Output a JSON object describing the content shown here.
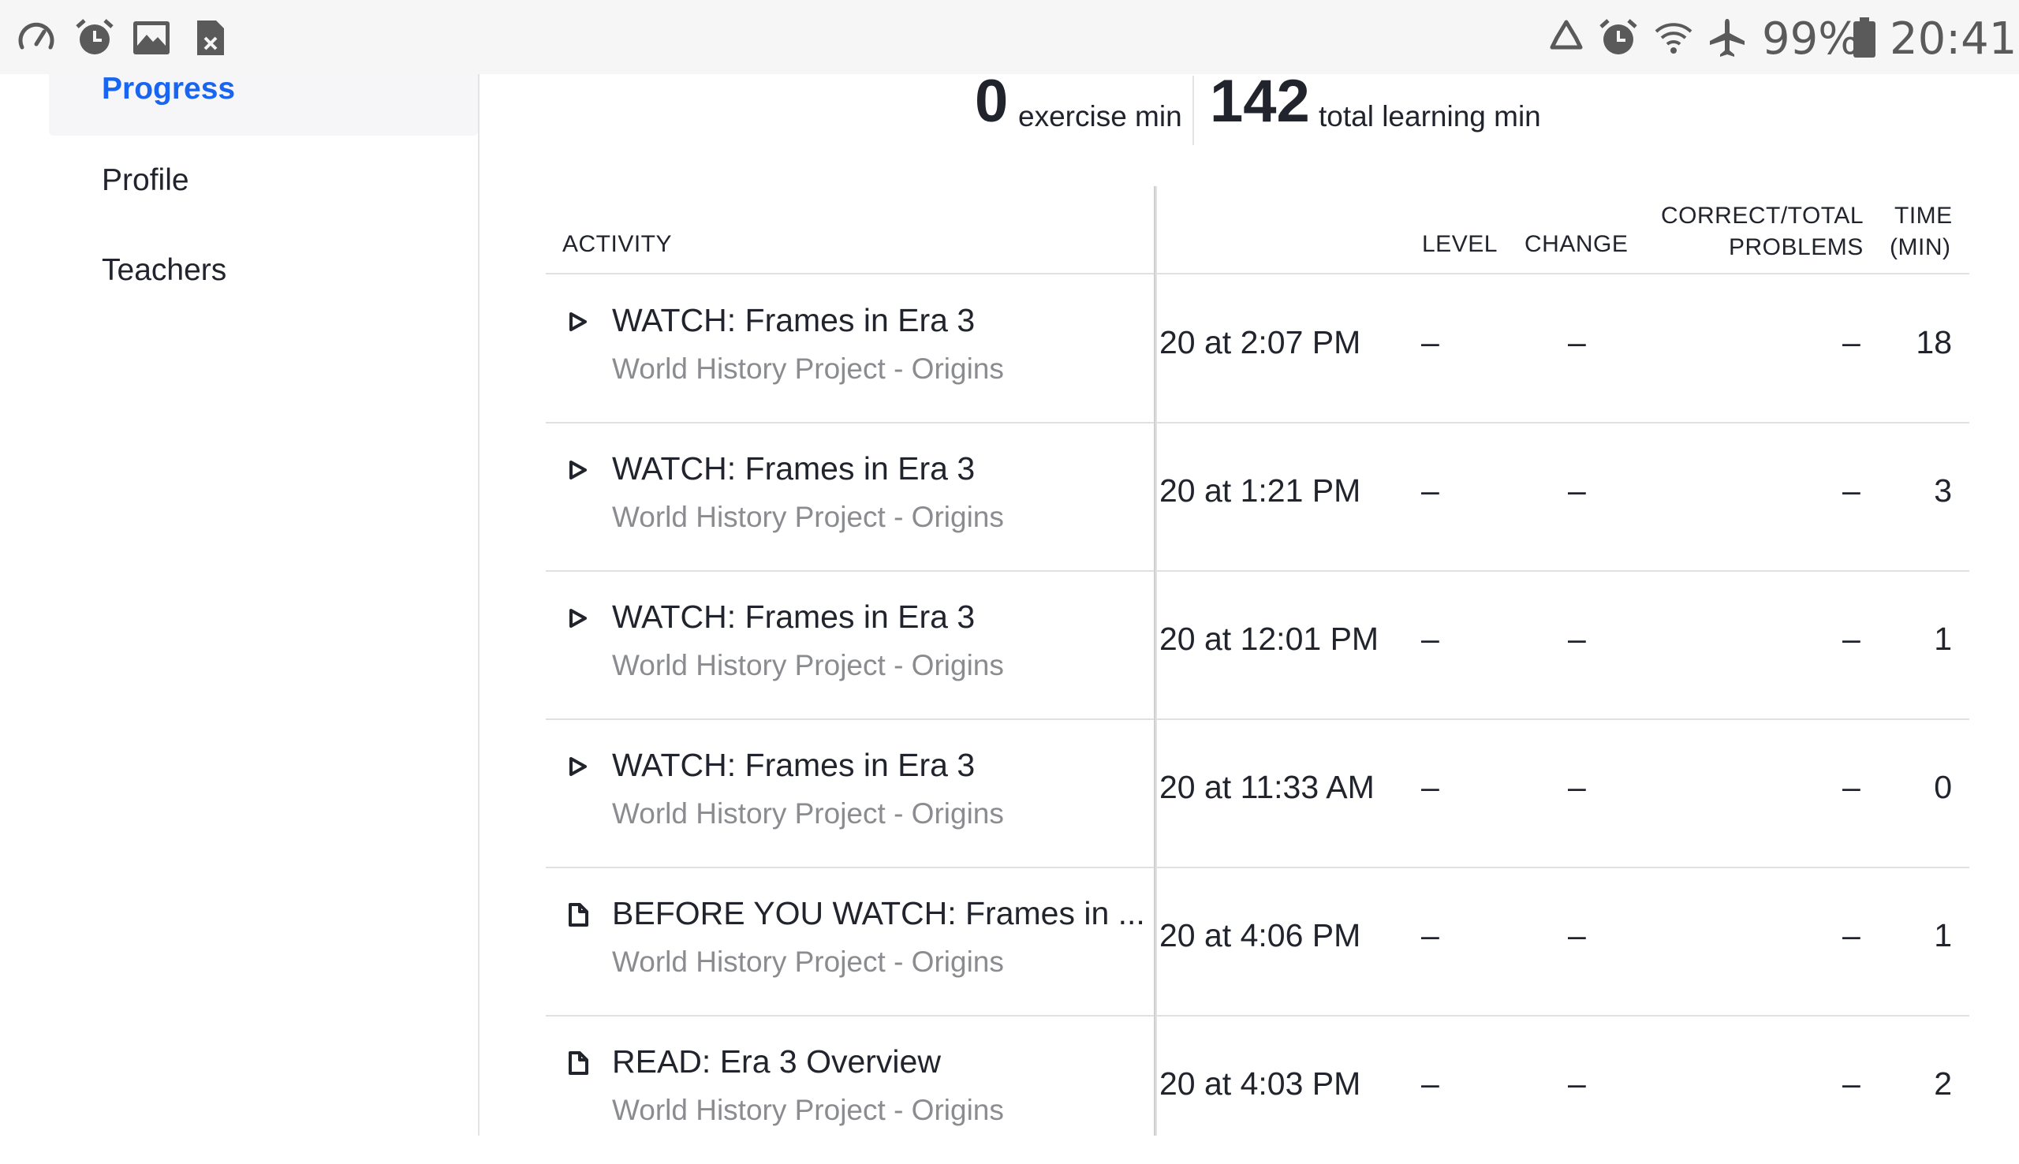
{
  "status_bar": {
    "left_icons": [
      "speedometer-icon",
      "alarm-icon",
      "image-icon",
      "sim-error-icon"
    ],
    "right_icons": [
      "recycle-icon",
      "alarm-icon",
      "wifi-icon",
      "airplane-icon",
      "battery-icon"
    ],
    "battery": "99%",
    "time": "20:41"
  },
  "sidebar": {
    "items": [
      {
        "label": "Progress",
        "active": true
      },
      {
        "label": "Profile",
        "active": false
      },
      {
        "label": "Teachers",
        "active": false
      }
    ]
  },
  "stats": {
    "exercise_value": "0",
    "exercise_label": "exercise min",
    "learning_value": "142",
    "learning_label": "total learning min"
  },
  "table": {
    "headers": {
      "activity": "ACTIVITY",
      "level": "LEVEL",
      "change": "CHANGE",
      "problems_line1": "CORRECT/TOTAL",
      "problems_line2": "PROBLEMS",
      "time_line1": "TIME",
      "time_line2": "(MIN)"
    },
    "rows": [
      {
        "icon": "play-icon",
        "title": "WATCH: Frames in Era 3",
        "subtitle": "World History Project - Origins",
        "date": "20 at 2:07 PM",
        "level": "–",
        "change": "–",
        "problems": "–",
        "time": "18"
      },
      {
        "icon": "play-icon",
        "title": "WATCH: Frames in Era 3",
        "subtitle": "World History Project - Origins",
        "date": "20 at 1:21 PM",
        "level": "–",
        "change": "–",
        "problems": "–",
        "time": "3"
      },
      {
        "icon": "play-icon",
        "title": "WATCH: Frames in Era 3",
        "subtitle": "World History Project - Origins",
        "date": "20 at 12:01 PM",
        "level": "–",
        "change": "–",
        "problems": "–",
        "time": "1"
      },
      {
        "icon": "play-icon",
        "title": "WATCH: Frames in Era 3",
        "subtitle": "World History Project - Origins",
        "date": "20 at 11:33 AM",
        "level": "–",
        "change": "–",
        "problems": "–",
        "time": "0"
      },
      {
        "icon": "article-icon",
        "title": "BEFORE YOU WATCH: Frames in ...",
        "subtitle": "World History Project - Origins",
        "date": "20 at 4:06 PM",
        "level": "–",
        "change": "–",
        "problems": "–",
        "time": "1"
      },
      {
        "icon": "article-icon",
        "title": "READ: Era 3 Overview",
        "subtitle": "World History Project - Origins",
        "date": "20 at 4:03 PM",
        "level": "–",
        "change": "–",
        "problems": "–",
        "time": "2"
      }
    ]
  },
  "colors": {
    "accent": "#1865f2",
    "text": "#21242c",
    "subtext": "#8a8c90",
    "status_icon": "#5a5a5a"
  }
}
